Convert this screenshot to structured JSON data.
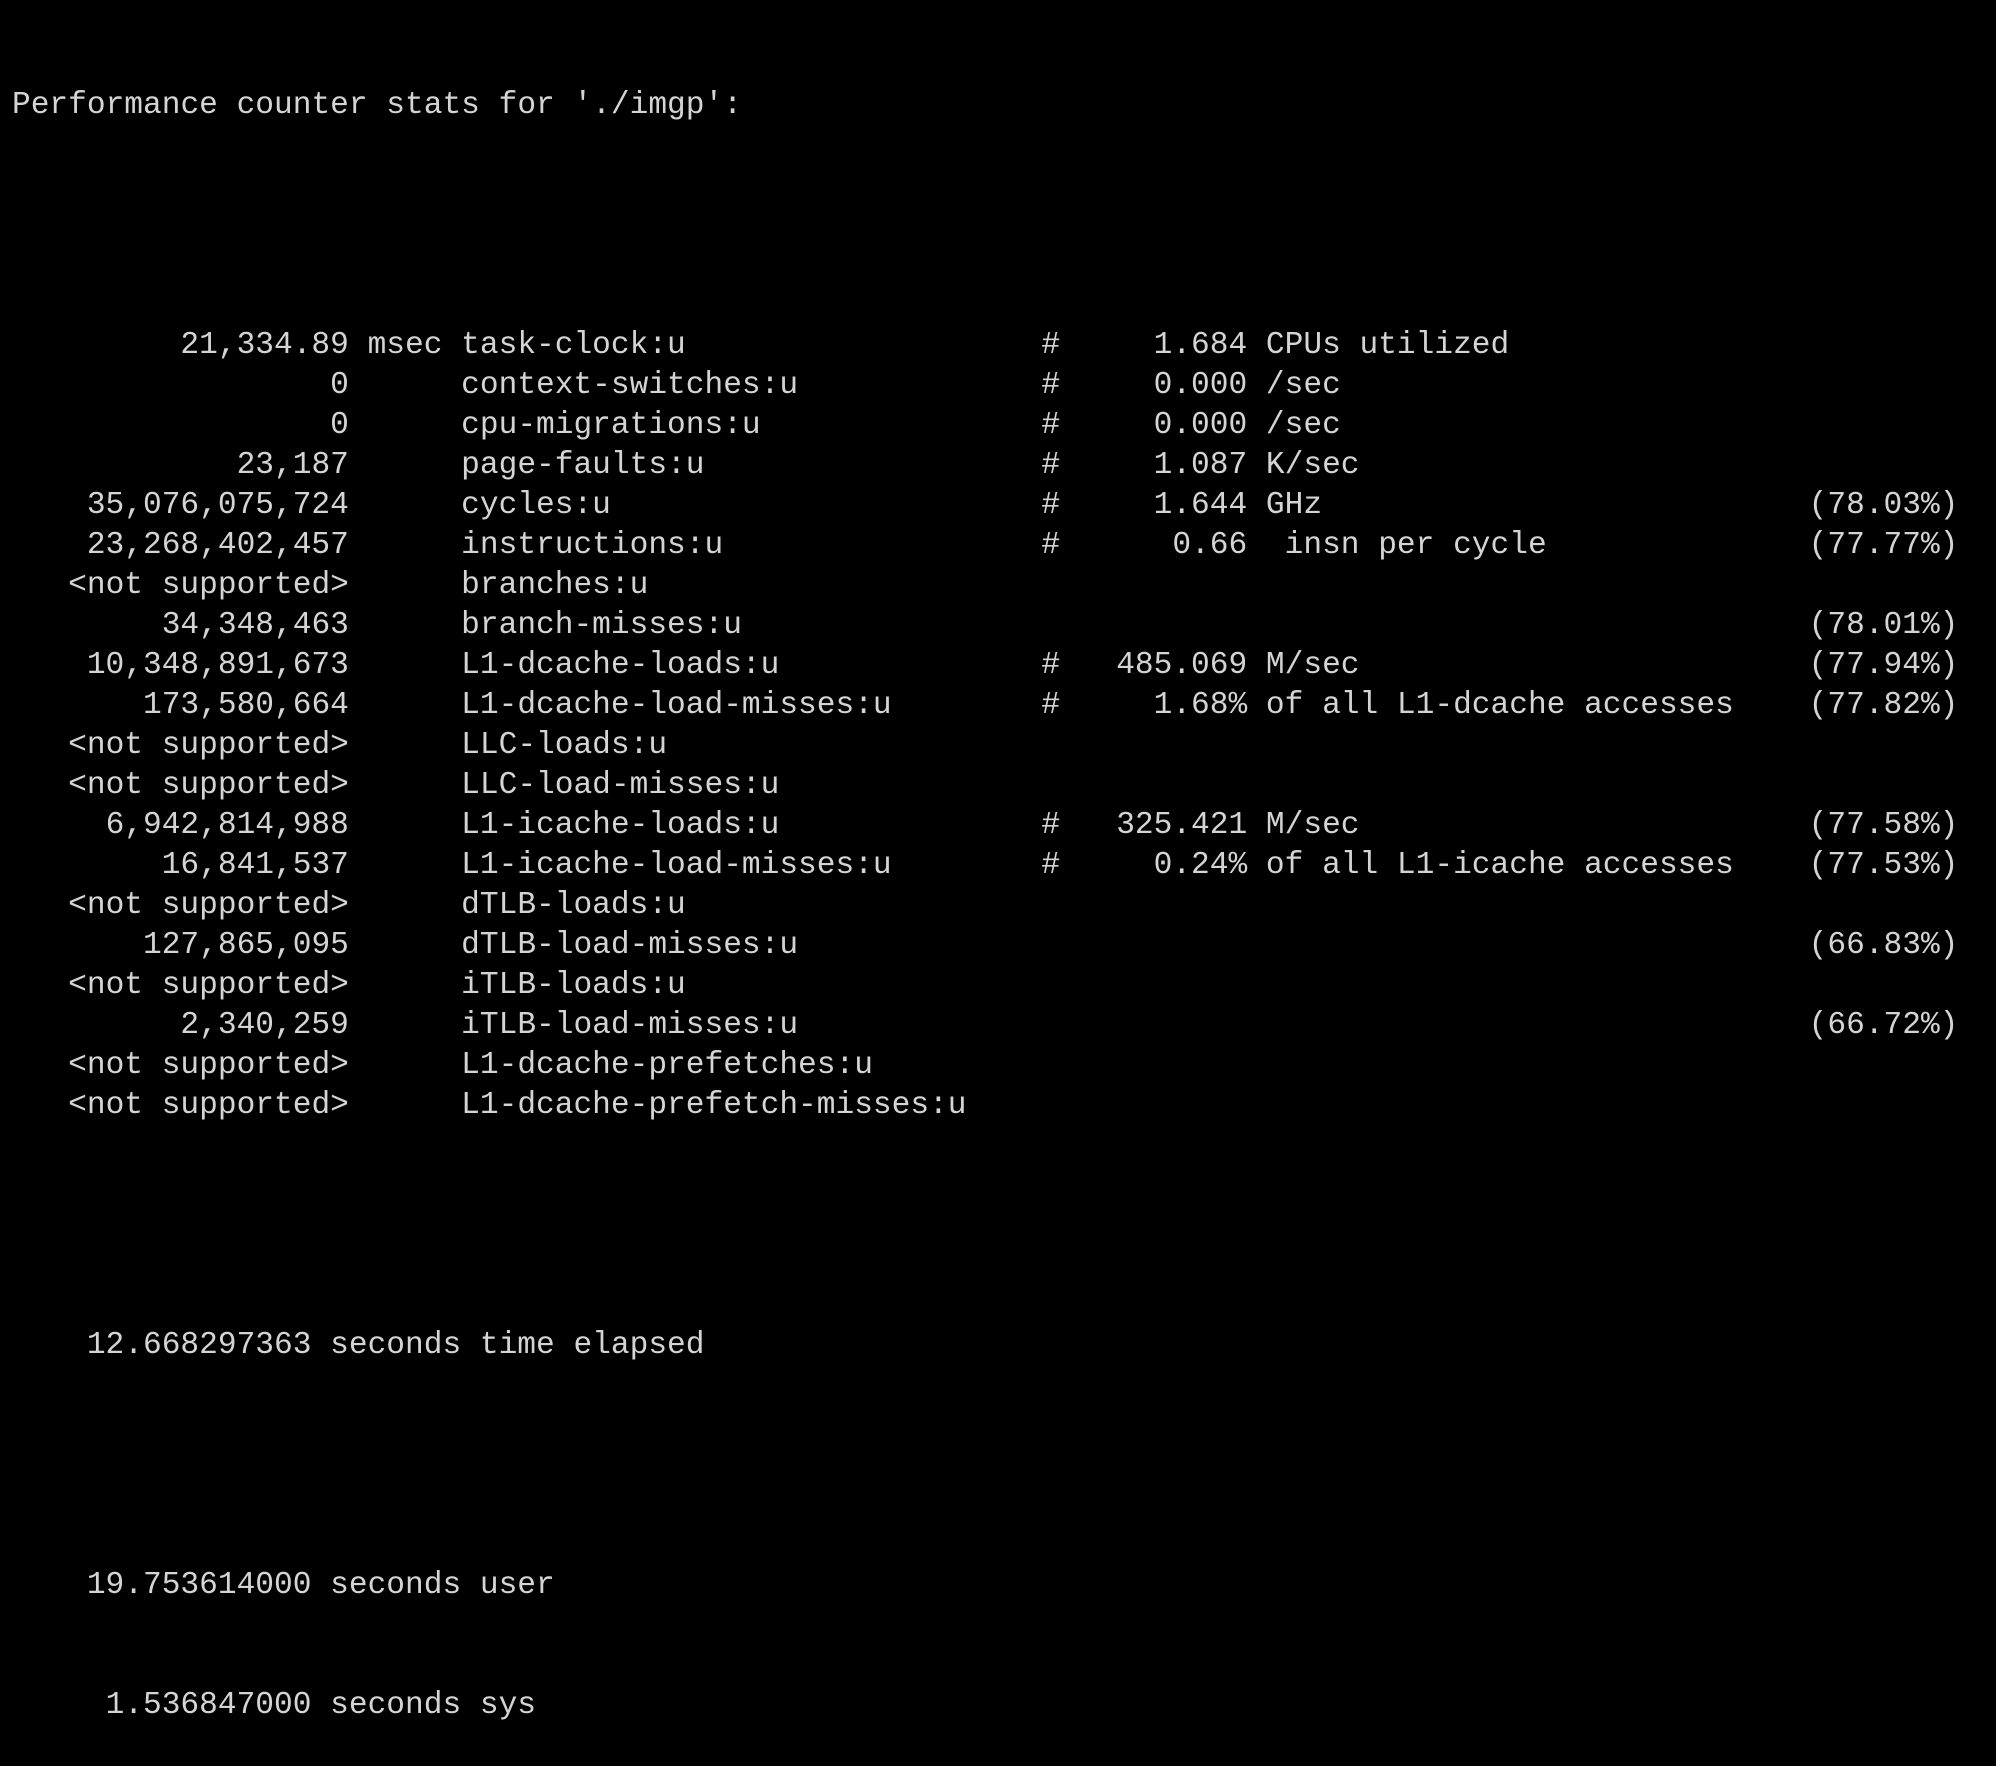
{
  "terminal": {
    "header": "Performance counter stats for './imgp':",
    "counters": [
      {
        "value": "21,334.89",
        "unit": "msec",
        "event": "task-clock:u",
        "hash": "#",
        "metric": "1.684",
        "metric_unit": "CPUs utilized",
        "percent": ""
      },
      {
        "value": "0",
        "unit": "",
        "event": "context-switches:u",
        "hash": "#",
        "metric": "0.000",
        "metric_unit": "/sec",
        "percent": ""
      },
      {
        "value": "0",
        "unit": "",
        "event": "cpu-migrations:u",
        "hash": "#",
        "metric": "0.000",
        "metric_unit": "/sec",
        "percent": ""
      },
      {
        "value": "23,187",
        "unit": "",
        "event": "page-faults:u",
        "hash": "#",
        "metric": "1.087",
        "metric_unit": "K/sec",
        "percent": ""
      },
      {
        "value": "35,076,075,724",
        "unit": "",
        "event": "cycles:u",
        "hash": "#",
        "metric": "1.644",
        "metric_unit": "GHz",
        "percent": "(78.03%)"
      },
      {
        "value": "23,268,402,457",
        "unit": "",
        "event": "instructions:u",
        "hash": "#",
        "metric": "0.66",
        "metric_unit": " insn per cycle",
        "percent": "(77.77%)"
      },
      {
        "value": "<not supported>",
        "unit": "",
        "event": "branches:u",
        "hash": "",
        "metric": "",
        "metric_unit": "",
        "percent": ""
      },
      {
        "value": "34,348,463",
        "unit": "",
        "event": "branch-misses:u",
        "hash": "",
        "metric": "",
        "metric_unit": "",
        "percent": "(78.01%)"
      },
      {
        "value": "10,348,891,673",
        "unit": "",
        "event": "L1-dcache-loads:u",
        "hash": "#",
        "metric": "485.069",
        "metric_unit": "M/sec",
        "percent": "(77.94%)"
      },
      {
        "value": "173,580,664",
        "unit": "",
        "event": "L1-dcache-load-misses:u",
        "hash": "#",
        "metric": "1.68%",
        "metric_unit": "of all L1-dcache accesses",
        "percent": "(77.82%)"
      },
      {
        "value": "<not supported>",
        "unit": "",
        "event": "LLC-loads:u",
        "hash": "",
        "metric": "",
        "metric_unit": "",
        "percent": ""
      },
      {
        "value": "<not supported>",
        "unit": "",
        "event": "LLC-load-misses:u",
        "hash": "",
        "metric": "",
        "metric_unit": "",
        "percent": ""
      },
      {
        "value": "6,942,814,988",
        "unit": "",
        "event": "L1-icache-loads:u",
        "hash": "#",
        "metric": "325.421",
        "metric_unit": "M/sec",
        "percent": "(77.58%)"
      },
      {
        "value": "16,841,537",
        "unit": "",
        "event": "L1-icache-load-misses:u",
        "hash": "#",
        "metric": "0.24%",
        "metric_unit": "of all L1-icache accesses",
        "percent": "(77.53%)"
      },
      {
        "value": "<not supported>",
        "unit": "",
        "event": "dTLB-loads:u",
        "hash": "",
        "metric": "",
        "metric_unit": "",
        "percent": ""
      },
      {
        "value": "127,865,095",
        "unit": "",
        "event": "dTLB-load-misses:u",
        "hash": "",
        "metric": "",
        "metric_unit": "",
        "percent": "(66.83%)"
      },
      {
        "value": "<not supported>",
        "unit": "",
        "event": "iTLB-loads:u",
        "hash": "",
        "metric": "",
        "metric_unit": "",
        "percent": ""
      },
      {
        "value": "2,340,259",
        "unit": "",
        "event": "iTLB-load-misses:u",
        "hash": "",
        "metric": "",
        "metric_unit": "",
        "percent": "(66.72%)"
      },
      {
        "value": "<not supported>",
        "unit": "",
        "event": "L1-dcache-prefetches:u",
        "hash": "",
        "metric": "",
        "metric_unit": "",
        "percent": ""
      },
      {
        "value": "<not supported>",
        "unit": "",
        "event": "L1-dcache-prefetch-misses:u",
        "hash": "",
        "metric": "",
        "metric_unit": "",
        "percent": ""
      }
    ],
    "elapsed": {
      "value": "12.668297363",
      "label": "seconds time elapsed"
    },
    "user": {
      "value": "19.753614000",
      "label": "seconds user"
    },
    "sys": {
      "value": "1.536847000",
      "label": "seconds sys"
    }
  },
  "colors": {
    "background": "#000000",
    "text": "#d4d4d4"
  }
}
